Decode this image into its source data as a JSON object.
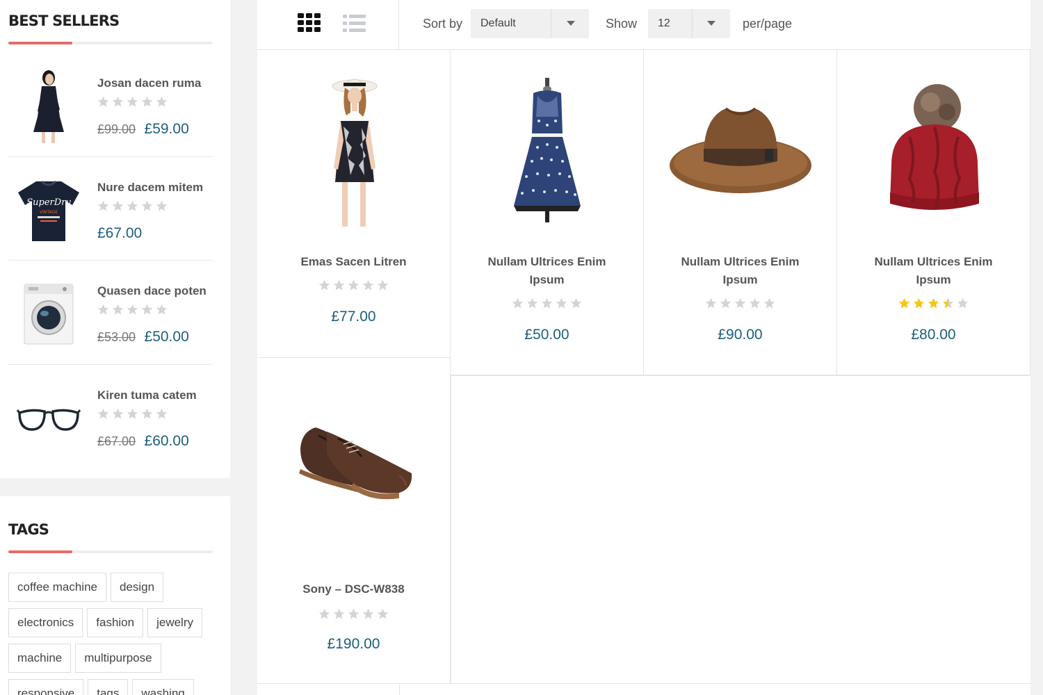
{
  "best_sellers": {
    "title": "Best Sellers",
    "items": [
      {
        "name": "Josan dacen ruma",
        "old_price": "£99.00",
        "price": "£59.00",
        "rating": 0,
        "image": "woman-dark-dress"
      },
      {
        "name": "Nure dacem mitem",
        "old_price": "",
        "price": "£67.00",
        "rating": 0,
        "image": "navy-tshirt"
      },
      {
        "name": "Quasen dace poten",
        "old_price": "£53.00",
        "price": "£50.00",
        "rating": 0,
        "image": "washing-machine"
      },
      {
        "name": "Kiren tuma catem",
        "old_price": "£67.00",
        "price": "£60.00",
        "rating": 0,
        "image": "eyeglasses"
      }
    ]
  },
  "tags": {
    "title": "Tags",
    "items": [
      "coffee machine",
      "design",
      "electronics",
      "fashion",
      "jewelry",
      "machine",
      "multipurpose",
      "responsive",
      "tags",
      "washing"
    ]
  },
  "toolbar": {
    "sort_label": "Sort by",
    "sort_value": "Default",
    "show_label": "Show",
    "show_value": "12",
    "per_page_label": "per/page",
    "grid_icon": "grid-view-icon",
    "list_icon": "list-view-icon"
  },
  "products": [
    {
      "name": "Emas Sacen Litren",
      "price": "£77.00",
      "rating": 0,
      "image": "woman-floral-romper-hat"
    },
    {
      "name": "Nullam Ultrices Enim Ipsum",
      "price": "£50.00",
      "rating": 0,
      "image": "polka-dot-dress"
    },
    {
      "name": "Nullam Ultrices Enim Ipsum",
      "price": "£90.00",
      "rating": 0,
      "image": "brown-fedora"
    },
    {
      "name": "Nullam Ultrices Enim Ipsum",
      "price": "£80.00",
      "rating": 3.5,
      "image": "red-knit-beanie"
    },
    {
      "name": "Sony – DSC-W838",
      "price": "£190.00",
      "rating": 0,
      "image": "brown-leather-shoes"
    }
  ],
  "colors": {
    "accent": "#e66a6a",
    "price": "#1b5e7e",
    "star_empty": "#d4d4d4",
    "star_filled": "#f5c518"
  }
}
